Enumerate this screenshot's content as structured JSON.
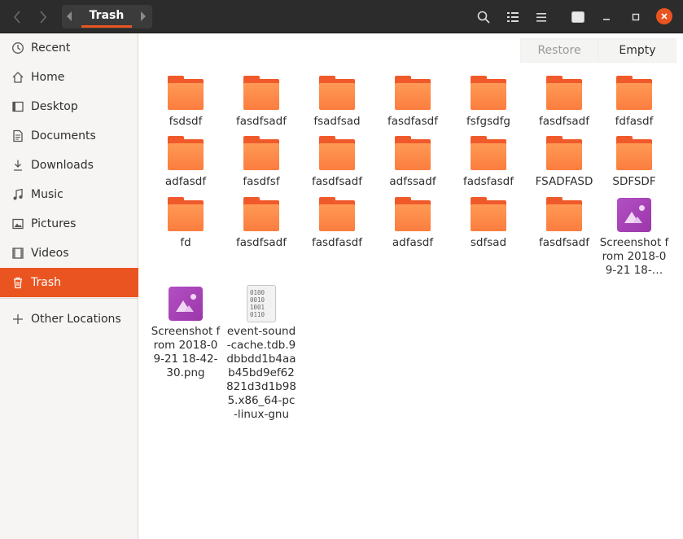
{
  "headerbar": {
    "path_label": "Trash",
    "icons": {
      "back": "chevron-left-icon",
      "forward": "chevron-right-icon",
      "search": "search-icon",
      "view": "list-view-icon",
      "menu": "hamburger-menu-icon",
      "extra": "window-icon",
      "minimize": "minimize-icon",
      "maximize": "maximize-icon",
      "close": "close-icon"
    }
  },
  "sidebar": {
    "items": [
      {
        "label": "Recent",
        "icon": "clock-icon"
      },
      {
        "label": "Home",
        "icon": "home-icon"
      },
      {
        "label": "Desktop",
        "icon": "desktop-icon"
      },
      {
        "label": "Documents",
        "icon": "document-icon"
      },
      {
        "label": "Downloads",
        "icon": "download-icon"
      },
      {
        "label": "Music",
        "icon": "music-icon"
      },
      {
        "label": "Pictures",
        "icon": "picture-icon"
      },
      {
        "label": "Videos",
        "icon": "video-icon"
      },
      {
        "label": "Trash",
        "icon": "trash-icon",
        "active": true
      }
    ],
    "other_locations": {
      "label": "Other Locations",
      "icon": "plus-icon"
    }
  },
  "actionbar": {
    "restore_label": "Restore",
    "empty_label": "Empty"
  },
  "files": [
    {
      "name": "fsdsdf",
      "type": "folder"
    },
    {
      "name": "fasdfsadf",
      "type": "folder"
    },
    {
      "name": "fsadfsad",
      "type": "folder"
    },
    {
      "name": "fasdfasdf",
      "type": "folder"
    },
    {
      "name": "fsfgsdfg",
      "type": "folder"
    },
    {
      "name": "fasdfsadf",
      "type": "folder"
    },
    {
      "name": "fdfasdf",
      "type": "folder"
    },
    {
      "name": "adfasdf",
      "type": "folder"
    },
    {
      "name": "fasdfsf",
      "type": "folder"
    },
    {
      "name": "fasdfsadf",
      "type": "folder"
    },
    {
      "name": "adfssadf",
      "type": "folder"
    },
    {
      "name": "fadsfasdf",
      "type": "folder"
    },
    {
      "name": "FSADFASD",
      "type": "folder"
    },
    {
      "name": "SDFSDF",
      "type": "folder"
    },
    {
      "name": "fd",
      "type": "folder"
    },
    {
      "name": "fasdfsadf",
      "type": "folder"
    },
    {
      "name": "fasdfasdf",
      "type": "folder"
    },
    {
      "name": "adfasdf",
      "type": "folder"
    },
    {
      "name": "sdfsad",
      "type": "folder"
    },
    {
      "name": "fasdfsadf",
      "type": "folder"
    },
    {
      "name": "Screenshot from 2018-09-21 18-…",
      "type": "image"
    },
    {
      "name": "Screenshot from 2018-09-21 18-42-30.png",
      "type": "image"
    },
    {
      "name": "event-sound-cache.tdb.9dbbdd1b4aab45bd9ef62821d3d1b985.x86_64-pc-linux-gnu",
      "type": "binary",
      "bits": "0100\n0010\n1001\n0110"
    }
  ]
}
